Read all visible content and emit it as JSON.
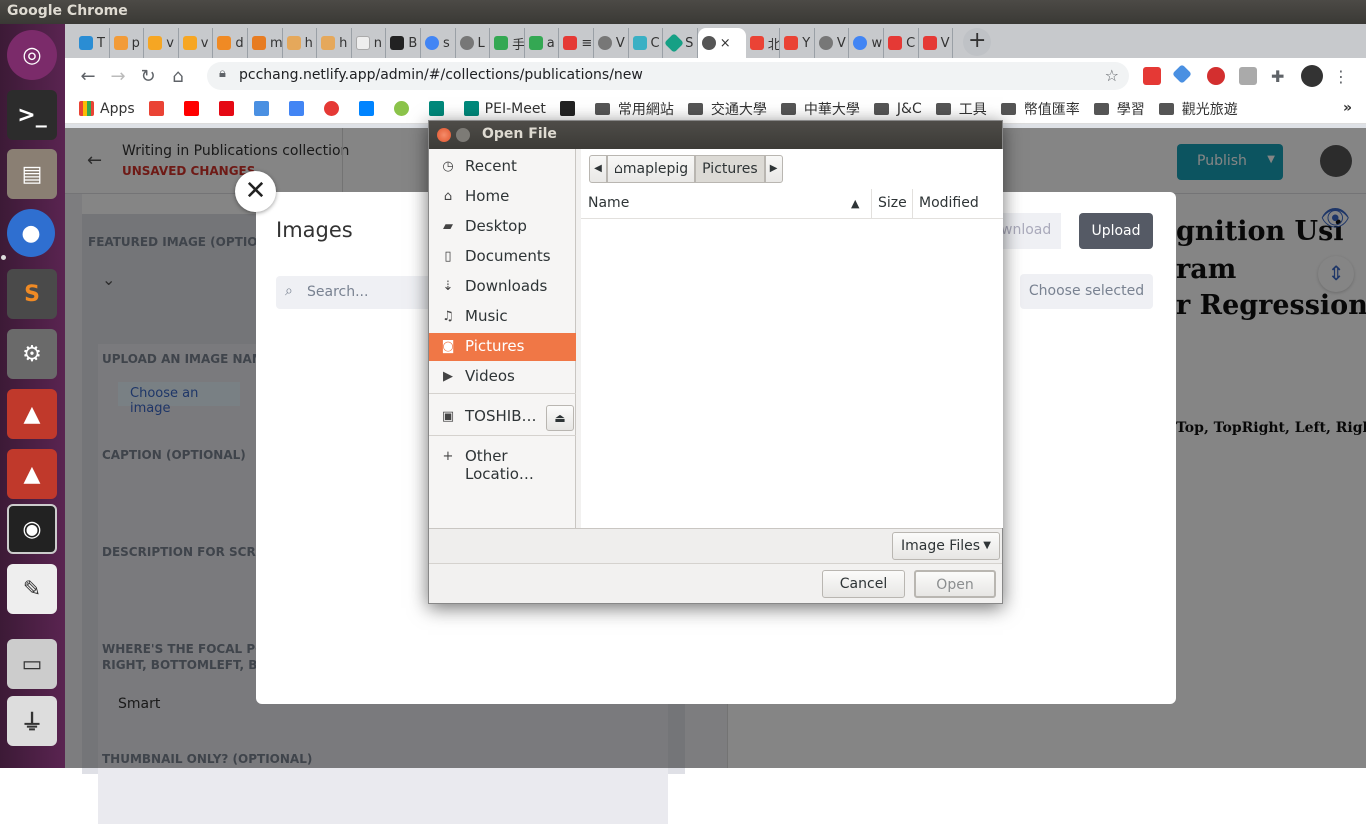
{
  "topbar": {
    "title": "Google Chrome"
  },
  "tabs": [
    "T",
    "p",
    "v",
    "v",
    "d",
    "m",
    "h",
    "h",
    "n",
    "B",
    "s",
    "L",
    "手",
    "a",
    "≡",
    "V",
    "C",
    "S",
    "×",
    "北",
    "Y",
    "V",
    "w",
    "C",
    "V"
  ],
  "address": {
    "url": "pcchang.netlify.app/admin/#/collections/publications/new"
  },
  "bookmarks": {
    "apps": "Apps",
    "pei": "PEI-Meet",
    "f1": "常用網站",
    "f2": "交通大學",
    "f3": "中華大學",
    "f4": "J&C",
    "f5": "工具",
    "f6": "幣值匯率",
    "f7": "學習",
    "f8": "觀光旅遊",
    "more": "»"
  },
  "cms": {
    "writing": "Writing in Publications collection",
    "unsaved": "UNSAVED CHANGES",
    "publish": "Publish",
    "featured": "FEATURED IMAGE (OPTIONA",
    "upload_name": "UPLOAD AN IMAGE NAME",
    "choose_image": "Choose an image",
    "caption": "CAPTION (OPTIONAL)",
    "description": "DESCRIPTION FOR SCREE",
    "focal1": "WHERE'S THE FOCAL POI",
    "focal2": "RIGHT, BOTTOMLEFT, BOT",
    "smart": "Smart",
    "thumbnail": "THUMBNAIL ONLY? (OPTIONAL)",
    "preview1": "gnition Usi",
    "preview2": "ram",
    "preview3": "r Regression",
    "preview4": "Top, TopRight, Left, Right,"
  },
  "media_modal": {
    "title": "Images",
    "search_placeholder": "Search...",
    "download": "wnload",
    "upload": "Upload",
    "choose_selected": "Choose selected"
  },
  "dialog": {
    "title": "Open File",
    "places": [
      "Recent",
      "Home",
      "Desktop",
      "Documents",
      "Downloads",
      "Music",
      "Pictures",
      "Videos",
      "TOSHIB…",
      "Other Locatio…"
    ],
    "path": [
      "maplepig",
      "Pictures"
    ],
    "columns": {
      "name": "Name",
      "size": "Size",
      "modified": "Modified"
    },
    "filter": "Image Files",
    "cancel": "Cancel",
    "open": "Open"
  }
}
